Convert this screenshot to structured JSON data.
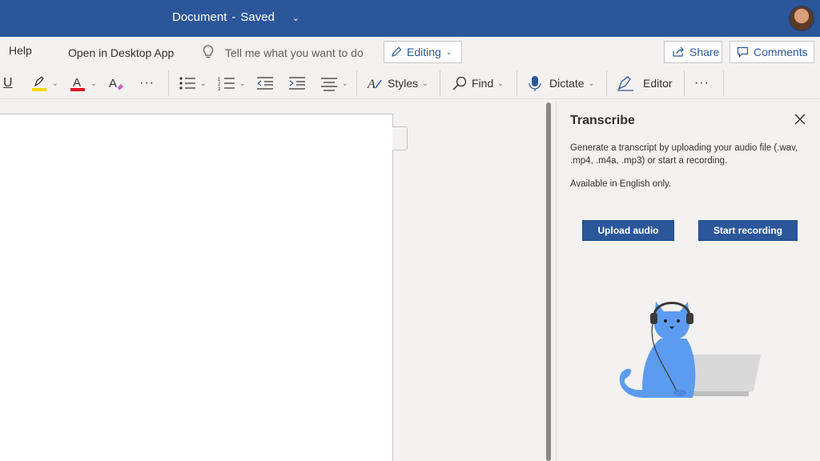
{
  "titlebar": {
    "doc_name": "Document",
    "separator": "-",
    "status": "Saved"
  },
  "menu": {
    "help": "Help",
    "open_desktop": "Open in Desktop App",
    "tell_me": "Tell me what you want to do",
    "editing": "Editing",
    "share": "Share",
    "comments": "Comments"
  },
  "toolbar": {
    "underline": "U",
    "more": "···",
    "styles": "Styles",
    "find": "Find",
    "dictate": "Dictate",
    "editor": "Editor",
    "more2": "···"
  },
  "transcribe": {
    "title": "Transcribe",
    "description": "Generate a transcript by uploading your audio file (.wav, .mp4, .m4a, .mp3) or start a recording.",
    "note": "Available in English only.",
    "upload_label": "Upload audio",
    "record_label": "Start recording"
  },
  "colors": {
    "brand": "#2b579a",
    "highlight": "#ffd800",
    "font_color": "#e81123"
  }
}
